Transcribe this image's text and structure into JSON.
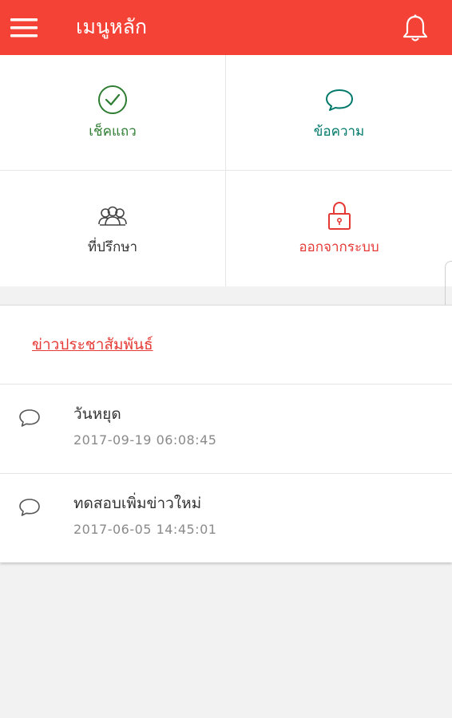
{
  "appbar": {
    "title": "เมนูหลัก",
    "menu_icon": "hamburger-menu-icon",
    "bell_icon": "bell-icon",
    "color": "#f44336"
  },
  "menu": {
    "items": [
      {
        "label": "เช็คแถว",
        "icon": "check-circle-icon",
        "color": "#2e7d32"
      },
      {
        "label": "ข้อความ",
        "icon": "chat-bubble-icon",
        "color": "#00796b"
      },
      {
        "label": "ที่ปรึกษา",
        "icon": "advisors-group-icon",
        "color": "#333333"
      },
      {
        "label": "ออกจากระบบ",
        "icon": "lock-icon",
        "color": "#e53935"
      }
    ]
  },
  "news": {
    "header": "ข่าวประชาสัมพันธ์",
    "items": [
      {
        "title": "วันหยุด",
        "date": "2017-09-19  06:08:45",
        "icon": "chat-bubble-icon"
      },
      {
        "title": "ทดสอบเพิ่มข่าวใหม่",
        "date": "2017-06-05  14:45:01",
        "icon": "chat-bubble-icon"
      }
    ]
  }
}
